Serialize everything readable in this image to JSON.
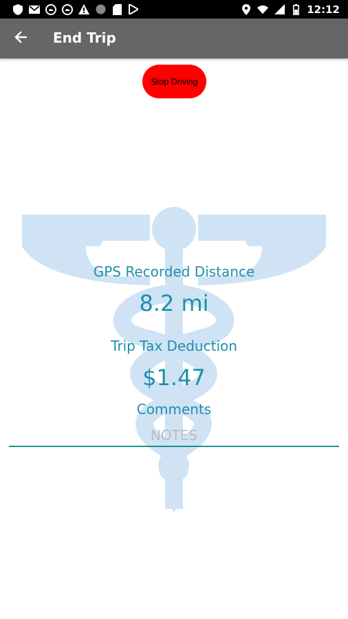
{
  "status_bar": {
    "time": "12:12",
    "left_icons": [
      "shield-icon",
      "mail-icon",
      "cloud-icon",
      "cloud-icon",
      "warning-icon",
      "circle-icon",
      "sd-card-icon",
      "play-store-icon"
    ],
    "right_icons": [
      "location-icon",
      "wifi-icon",
      "signal-icon",
      "battery-icon"
    ]
  },
  "app_bar": {
    "title": "End Trip",
    "back_icon": "arrow-left-icon"
  },
  "stop_button": {
    "label": "Stop Driving",
    "color": "#ff0000"
  },
  "trip": {
    "gps_label": "GPS Recorded Distance",
    "gps_value": "8.2 mi",
    "tax_label": "Trip Tax Deduction",
    "tax_value": "$1.47",
    "comments_label": "Comments",
    "notes_placeholder": "NOTES"
  },
  "colors": {
    "accent_text": "#1f8faa",
    "app_bar": "#666666",
    "watermark": "#cfe3f5"
  }
}
